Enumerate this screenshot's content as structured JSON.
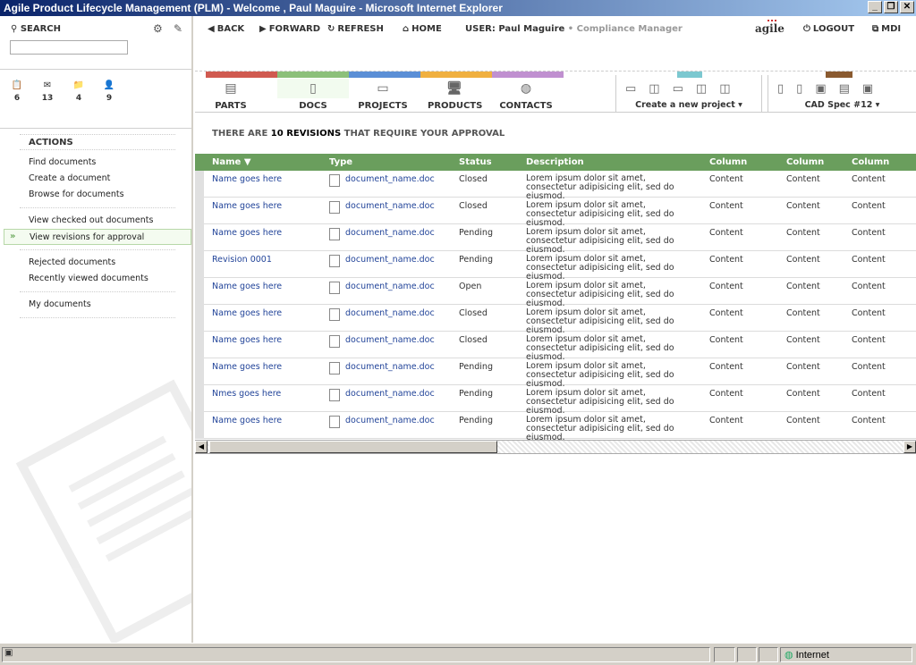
{
  "window": {
    "title": "Agile Product Lifecycle Management (PLM) - Welcome , Paul Maguire - Microsoft Internet Explorer",
    "minimize": "_",
    "restore": "❐",
    "close": "✕"
  },
  "search": {
    "label": "SEARCH",
    "icon": "search-icon",
    "placeholder": "",
    "value": ""
  },
  "counters": [
    {
      "icon": "clipboard-icon",
      "count": "6"
    },
    {
      "icon": "mail-icon",
      "count": "13"
    },
    {
      "icon": "folder-icon",
      "count": "4"
    },
    {
      "icon": "contact-card-icon",
      "count": "9"
    }
  ],
  "actions": {
    "heading": "ACTIONS",
    "group1": [
      "Find documents",
      "Create a document",
      "Browse for documents"
    ],
    "group2": [
      "View checked out documents",
      "View revisions for approval"
    ],
    "group3": [
      "Rejected documents",
      "Recently viewed documents"
    ],
    "group4": [
      "My documents"
    ],
    "active": "View revisions for approval"
  },
  "nav": {
    "back": "BACK",
    "forward": "FORWARD",
    "refresh": "REFRESH",
    "home": "HOME",
    "user_label": "USER:",
    "user_name": "Paul Maguire",
    "user_role": "• Compliance Manager",
    "logo": "agile",
    "logout": "LOGOUT",
    "mdi": "MDI"
  },
  "modules": [
    {
      "label": "PARTS",
      "icon": "parts-icon",
      "color": "#d05a50"
    },
    {
      "label": "DOCS",
      "icon": "document-icon",
      "color": "#8cc07a"
    },
    {
      "label": "PROJECTS",
      "icon": "projects-icon",
      "color": "#5b8fd6"
    },
    {
      "label": "PRODUCTS",
      "icon": "monitor-icon",
      "color": "#f0b040"
    },
    {
      "label": "CONTACTS",
      "icon": "globe-icon",
      "color": "#c090d0"
    }
  ],
  "project_dropdown": "Create a new project",
  "cad_dropdown": "CAD Spec #12",
  "heading": {
    "pre": "THERE ARE",
    "count": "10 REVISIONS",
    "post": "THAT REQUIRE YOUR APPROVAL"
  },
  "table": {
    "columns": [
      "Name",
      "Type",
      "Status",
      "Description",
      "Column",
      "Column",
      "Column"
    ],
    "sort_indicator": "▼",
    "rows": [
      {
        "name": "Name goes here",
        "type": "document_name.doc",
        "status": "Closed",
        "desc": "Lorem ipsum dolor sit amet, consectetur adipisicing elit, sed do eiusmod.",
        "c1": "Content",
        "c2": "Content",
        "c3": "Content"
      },
      {
        "name": "Name goes here",
        "type": "document_name.doc",
        "status": "Closed",
        "desc": "Lorem ipsum dolor sit amet, consectetur adipisicing elit, sed do eiusmod.",
        "c1": "Content",
        "c2": "Content",
        "c3": "Content"
      },
      {
        "name": "Name goes here",
        "type": "document_name.doc",
        "status": "Pending",
        "desc": "Lorem ipsum dolor sit amet, consectetur adipisicing elit, sed do eiusmod.",
        "c1": "Content",
        "c2": "Content",
        "c3": "Content"
      },
      {
        "name": "Revision 0001",
        "type": "document_name.doc",
        "status": "Pending",
        "desc": "Lorem ipsum dolor sit amet, consectetur adipisicing elit, sed do eiusmod.",
        "c1": "Content",
        "c2": "Content",
        "c3": "Content"
      },
      {
        "name": "Name goes here",
        "type": "document_name.doc",
        "status": "Open",
        "desc": "Lorem ipsum dolor sit amet, consectetur adipisicing elit, sed do eiusmod.",
        "c1": "Content",
        "c2": "Content",
        "c3": "Content"
      },
      {
        "name": "Name goes here",
        "type": "document_name.doc",
        "status": "Closed",
        "desc": "Lorem ipsum dolor sit amet, consectetur adipisicing elit, sed do eiusmod.",
        "c1": "Content",
        "c2": "Content",
        "c3": "Content"
      },
      {
        "name": "Name goes here",
        "type": "document_name.doc",
        "status": "Closed",
        "desc": "Lorem ipsum dolor sit amet, consectetur adipisicing elit, sed do eiusmod.",
        "c1": "Content",
        "c2": "Content",
        "c3": "Content"
      },
      {
        "name": "Name goes here",
        "type": "document_name.doc",
        "status": "Pending",
        "desc": "Lorem ipsum dolor sit amet, consectetur adipisicing elit, sed do eiusmod.",
        "c1": "Content",
        "c2": "Content",
        "c3": "Content"
      },
      {
        "name": "Nmes goes here",
        "type": "document_name.doc",
        "status": "Pending",
        "desc": "Lorem ipsum dolor sit amet, consectetur adipisicing elit, sed do eiusmod.",
        "c1": "Content",
        "c2": "Content",
        "c3": "Content"
      },
      {
        "name": "Name goes here",
        "type": "document_name.doc",
        "status": "Pending",
        "desc": "Lorem ipsum dolor sit amet, consectetur adipisicing elit, sed do eiusmod.",
        "c1": "Content",
        "c2": "Content",
        "c3": "Content"
      }
    ]
  },
  "statusbar": {
    "zone": "Internet"
  },
  "colors": {
    "table_header": "#6a9e5d",
    "link": "#224499"
  }
}
